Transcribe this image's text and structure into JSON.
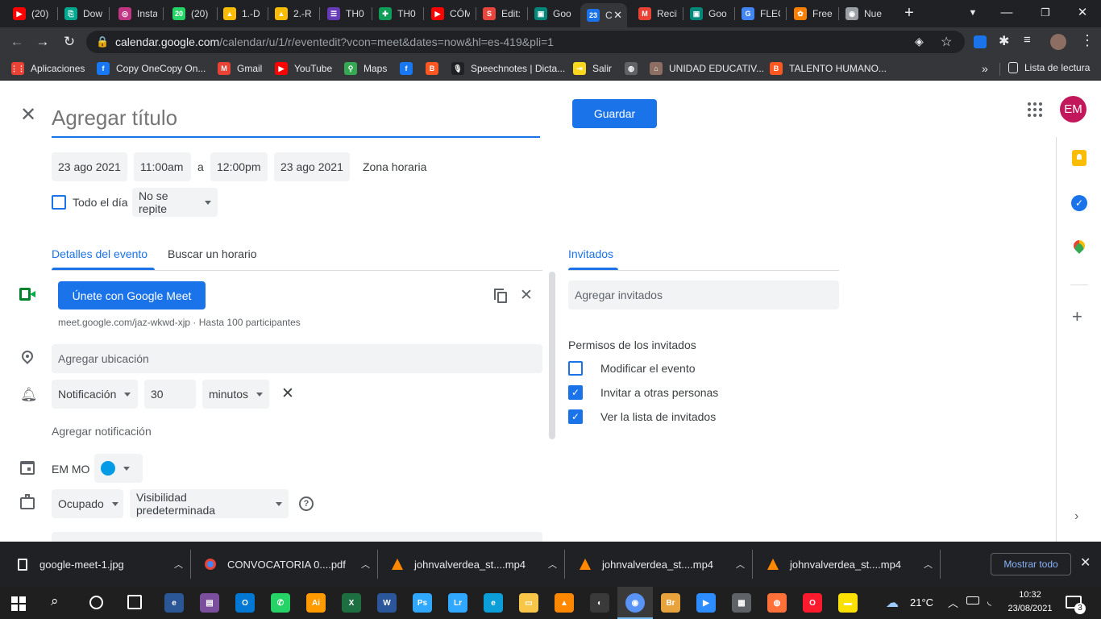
{
  "tabs": [
    {
      "label": "(20)",
      "icon": "youtube-icon",
      "color": "#ff0000",
      "glyph": "▶"
    },
    {
      "label": "Dow",
      "icon": "onecopy-icon",
      "color": "#00a88f",
      "glyph": "⎘"
    },
    {
      "label": "Insta",
      "icon": "instagram-icon",
      "color": "#c13584",
      "glyph": "◎"
    },
    {
      "label": "(20)",
      "icon": "whatsapp-icon",
      "color": "#25d366",
      "glyph": "20"
    },
    {
      "label": "1.-D",
      "icon": "drive-icon",
      "color": "#fbbc04",
      "glyph": "▲"
    },
    {
      "label": "2.-R",
      "icon": "drive-icon",
      "color": "#fbbc04",
      "glyph": "▲"
    },
    {
      "label": "TH0",
      "icon": "forms-icon",
      "color": "#673ab7",
      "glyph": "☰"
    },
    {
      "label": "TH0",
      "icon": "sheets-icon",
      "color": "#0f9d58",
      "glyph": "✚"
    },
    {
      "label": "CÓM",
      "icon": "youtube-icon",
      "color": "#ff0000",
      "glyph": "▶"
    },
    {
      "label": "Edit:",
      "icon": "sites-icon",
      "color": "#e8453c",
      "glyph": "S"
    },
    {
      "label": "Goo",
      "icon": "meet-icon",
      "color": "#00897b",
      "glyph": "▣"
    },
    {
      "label": "C",
      "icon": "calendar-icon",
      "color": "#1a73e8",
      "glyph": "23"
    },
    {
      "label": "Recil",
      "icon": "gmail-icon",
      "color": "#ea4335",
      "glyph": "M"
    },
    {
      "label": "Goo",
      "icon": "meet-icon",
      "color": "#00897b",
      "glyph": "▣"
    },
    {
      "label": "FLEC",
      "icon": "google-icon",
      "color": "#4285f4",
      "glyph": "G"
    },
    {
      "label": "Free",
      "icon": "freepik-icon",
      "color": "#ff7f00",
      "glyph": "✿"
    },
    {
      "label": "Nue",
      "icon": "chrome-icon",
      "color": "#9aa0a6",
      "glyph": "◉"
    }
  ],
  "browser": {
    "url_host": "calendar.google.com",
    "url_path": "/calendar/u/1/r/eventedit?vcon=meet&dates=now&hl=es-419&pli=1",
    "new_tab_glyph": "+",
    "reading_list": "Lista de lectura"
  },
  "bookmarks": [
    {
      "label": "Aplicaciones",
      "icon": "apps-grid-icon",
      "color": "#ea4335",
      "glyph": "⋮⋮"
    },
    {
      "label": "Copy OneCopy On...",
      "icon": "facebook-icon",
      "color": "#1877f2",
      "glyph": "f"
    },
    {
      "label": "Gmail",
      "icon": "gmail-icon",
      "color": "#ea4335",
      "glyph": "M"
    },
    {
      "label": "YouTube",
      "icon": "youtube-icon",
      "color": "#ff0000",
      "glyph": "▶"
    },
    {
      "label": "Maps",
      "icon": "maps-icon",
      "color": "#34a853",
      "glyph": "⚲"
    },
    {
      "label": "",
      "icon": "facebook-icon",
      "color": "#1877f2",
      "glyph": "f"
    },
    {
      "label": "",
      "icon": "blogger-icon",
      "color": "#ff5722",
      "glyph": "B"
    },
    {
      "label": "Speechnotes | Dicta...",
      "icon": "microphone-icon",
      "color": "#202124",
      "glyph": "🎙"
    },
    {
      "label": "Salir",
      "icon": "salir-icon",
      "color": "#f9d71c",
      "glyph": "⇥"
    },
    {
      "label": "",
      "icon": "globe-icon",
      "color": "#5f6368",
      "glyph": "◍"
    },
    {
      "label": "UNIDAD EDUCATIV...",
      "icon": "school-icon",
      "color": "#8d6e63",
      "glyph": "⌂"
    },
    {
      "label": "TALENTO HUMANO...",
      "icon": "blogger-icon",
      "color": "#ff5722",
      "glyph": "B"
    }
  ],
  "event": {
    "title_placeholder": "Agregar título",
    "save_label": "Guardar",
    "start_date": "23 ago 2021",
    "start_time": "11:00am",
    "to_label": "a",
    "end_time": "12:00pm",
    "end_date": "23 ago 2021",
    "timezone_label": "Zona horaria",
    "all_day_label": "Todo el día",
    "repeat_value": "No se repite",
    "avatar_initials": "EM",
    "avatar_color": "#c2185b"
  },
  "details": {
    "tab_details": "Detalles del evento",
    "tab_find_time": "Buscar un horario",
    "meet_button": "Únete con Google Meet",
    "meet_info": "meet.google.com/jaz-wkwd-xjp · Hasta 100 participantes",
    "location_placeholder": "Agregar ubicación",
    "notification_type": "Notificación",
    "notification_amount": "30",
    "notification_unit": "minutos",
    "add_notification": "Agregar notificación",
    "calendar_owner": "EM MO",
    "calendar_color": "#039be5",
    "availability": "Ocupado",
    "visibility": "Visibilidad predeterminada"
  },
  "guests": {
    "tab_label": "Invitados",
    "add_placeholder": "Agregar invitados",
    "permissions_title": "Permisos de los invitados",
    "permissions": [
      {
        "label": "Modificar el evento",
        "checked": false
      },
      {
        "label": "Invitar a otras personas",
        "checked": true
      },
      {
        "label": "Ver la lista de invitados",
        "checked": true
      }
    ]
  },
  "downloads": {
    "items": [
      {
        "name": "google-meet-1.jpg",
        "icon": "image-file-icon"
      },
      {
        "name": "CONVOCATORIA 0....pdf",
        "icon": "chrome-pdf-icon"
      },
      {
        "name": "johnvalverdea_st....mp4",
        "icon": "vlc-icon"
      },
      {
        "name": "johnvalverdea_st....mp4",
        "icon": "vlc-icon"
      },
      {
        "name": "johnvalverdea_st....mp4",
        "icon": "vlc-icon"
      }
    ],
    "show_all": "Mostrar todo"
  },
  "taskbar": {
    "weather": "21°C",
    "time": "10:32",
    "date": "23/08/2021",
    "notifications": "3",
    "apps": [
      {
        "icon": "edge-legacy-icon",
        "color": "#2b5797",
        "glyph": "e"
      },
      {
        "icon": "winrar-icon",
        "color": "#7b4f9d",
        "glyph": "▤"
      },
      {
        "icon": "outlook-icon",
        "color": "#0078d4",
        "glyph": "O"
      },
      {
        "icon": "whatsapp-icon",
        "color": "#25d366",
        "glyph": "✆"
      },
      {
        "icon": "illustrator-icon",
        "color": "#ff9a00",
        "glyph": "Ai"
      },
      {
        "icon": "excel-icon",
        "color": "#1d6f42",
        "glyph": "X"
      },
      {
        "icon": "word-icon",
        "color": "#2b579a",
        "glyph": "W"
      },
      {
        "icon": "photoshop-icon",
        "color": "#31a8ff",
        "glyph": "Ps"
      },
      {
        "icon": "lightroom-icon",
        "color": "#31a8ff",
        "glyph": "Lr"
      },
      {
        "icon": "edge-icon",
        "color": "#0c9ed9",
        "glyph": "e"
      },
      {
        "icon": "file-explorer-icon",
        "color": "#f8c749",
        "glyph": "▭"
      },
      {
        "icon": "vlc-icon",
        "color": "#ff8800",
        "glyph": "▲"
      },
      {
        "icon": "obs-icon",
        "color": "#3a3a3a",
        "glyph": "◐"
      },
      {
        "icon": "chrome-icon",
        "color": "#4285f4",
        "glyph": "◉"
      },
      {
        "icon": "bridge-icon",
        "color": "#e8a33d",
        "glyph": "Br"
      },
      {
        "icon": "zoom-icon",
        "color": "#2d8cff",
        "glyph": "▶"
      },
      {
        "icon": "calculator-icon",
        "color": "#5f6368",
        "glyph": "▦"
      },
      {
        "icon": "firefox-icon",
        "color": "#ff7139",
        "glyph": "◍"
      },
      {
        "icon": "opera-icon",
        "color": "#ff1b2d",
        "glyph": "O"
      },
      {
        "icon": "sticky-notes-icon",
        "color": "#fce100",
        "glyph": "▬"
      }
    ]
  }
}
